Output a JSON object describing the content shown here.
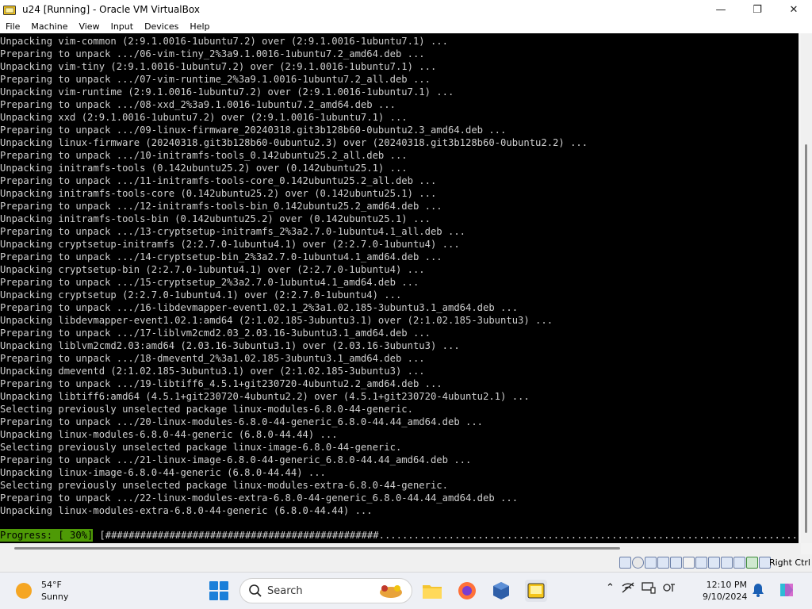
{
  "window": {
    "title": "u24 [Running] - Oracle VM VirtualBox",
    "controls": {
      "minimize": "—",
      "maximize": "❐",
      "close": "✕"
    }
  },
  "menu": [
    "File",
    "Machine",
    "View",
    "Input",
    "Devices",
    "Help"
  ],
  "terminal": {
    "lines": [
      "Unpacking vim-common (2:9.1.0016-1ubuntu7.2) over (2:9.1.0016-1ubuntu7.1) ...",
      "Preparing to unpack .../06-vim-tiny_2%3a9.1.0016-1ubuntu7.2_amd64.deb ...",
      "Unpacking vim-tiny (2:9.1.0016-1ubuntu7.2) over (2:9.1.0016-1ubuntu7.1) ...",
      "Preparing to unpack .../07-vim-runtime_2%3a9.1.0016-1ubuntu7.2_all.deb ...",
      "Unpacking vim-runtime (2:9.1.0016-1ubuntu7.2) over (2:9.1.0016-1ubuntu7.1) ...",
      "Preparing to unpack .../08-xxd_2%3a9.1.0016-1ubuntu7.2_amd64.deb ...",
      "Unpacking xxd (2:9.1.0016-1ubuntu7.2) over (2:9.1.0016-1ubuntu7.1) ...",
      "Preparing to unpack .../09-linux-firmware_20240318.git3b128b60-0ubuntu2.3_amd64.deb ...",
      "Unpacking linux-firmware (20240318.git3b128b60-0ubuntu2.3) over (20240318.git3b128b60-0ubuntu2.2) ...",
      "Preparing to unpack .../10-initramfs-tools_0.142ubuntu25.2_all.deb ...",
      "Unpacking initramfs-tools (0.142ubuntu25.2) over (0.142ubuntu25.1) ...",
      "Preparing to unpack .../11-initramfs-tools-core_0.142ubuntu25.2_all.deb ...",
      "Unpacking initramfs-tools-core (0.142ubuntu25.2) over (0.142ubuntu25.1) ...",
      "Preparing to unpack .../12-initramfs-tools-bin_0.142ubuntu25.2_amd64.deb ...",
      "Unpacking initramfs-tools-bin (0.142ubuntu25.2) over (0.142ubuntu25.1) ...",
      "Preparing to unpack .../13-cryptsetup-initramfs_2%3a2.7.0-1ubuntu4.1_all.deb ...",
      "Unpacking cryptsetup-initramfs (2:2.7.0-1ubuntu4.1) over (2:2.7.0-1ubuntu4) ...",
      "Preparing to unpack .../14-cryptsetup-bin_2%3a2.7.0-1ubuntu4.1_amd64.deb ...",
      "Unpacking cryptsetup-bin (2:2.7.0-1ubuntu4.1) over (2:2.7.0-1ubuntu4) ...",
      "Preparing to unpack .../15-cryptsetup_2%3a2.7.0-1ubuntu4.1_amd64.deb ...",
      "Unpacking cryptsetup (2:2.7.0-1ubuntu4.1) over (2:2.7.0-1ubuntu4) ...",
      "Preparing to unpack .../16-libdevmapper-event1.02.1_2%3a1.02.185-3ubuntu3.1_amd64.deb ...",
      "Unpacking libdevmapper-event1.02.1:amd64 (2:1.02.185-3ubuntu3.1) over (2:1.02.185-3ubuntu3) ...",
      "Preparing to unpack .../17-liblvm2cmd2.03_2.03.16-3ubuntu3.1_amd64.deb ...",
      "Unpacking liblvm2cmd2.03:amd64 (2.03.16-3ubuntu3.1) over (2.03.16-3ubuntu3) ...",
      "Preparing to unpack .../18-dmeventd_2%3a1.02.185-3ubuntu3.1_amd64.deb ...",
      "Unpacking dmeventd (2:1.02.185-3ubuntu3.1) over (2:1.02.185-3ubuntu3) ...",
      "Preparing to unpack .../19-libtiff6_4.5.1+git230720-4ubuntu2.2_amd64.deb ...",
      "Unpacking libtiff6:amd64 (4.5.1+git230720-4ubuntu2.2) over (4.5.1+git230720-4ubuntu2.1) ...",
      "Selecting previously unselected package linux-modules-6.8.0-44-generic.",
      "Preparing to unpack .../20-linux-modules-6.8.0-44-generic_6.8.0-44.44_amd64.deb ...",
      "Unpacking linux-modules-6.8.0-44-generic (6.8.0-44.44) ...",
      "Selecting previously unselected package linux-image-6.8.0-44-generic.",
      "Preparing to unpack .../21-linux-image-6.8.0-44-generic_6.8.0-44.44_amd64.deb ...",
      "Unpacking linux-image-6.8.0-44-generic (6.8.0-44.44) ...",
      "Selecting previously unselected package linux-modules-extra-6.8.0-44-generic.",
      "Preparing to unpack .../22-linux-modules-extra-6.8.0-44-generic_6.8.0-44.44_amd64.deb ...",
      "Unpacking linux-modules-extra-6.8.0-44-generic (6.8.0-44.44) ..."
    ],
    "progress_label": "Progress: [ 30%]",
    "progress_bar": "[###############################################.........................................................................................................................................]"
  },
  "statusbar": {
    "host_key": "Right Ctrl",
    "icons": [
      "hard-disk-icon",
      "optical-drive-icon",
      "audio-icon",
      "network-icon",
      "usb-icon",
      "shared-folders-icon",
      "display-icon",
      "recording-icon",
      "mouse-integration-icon",
      "keyboard-icon",
      "cpu-icon",
      "arrow-icon"
    ]
  },
  "taskbar": {
    "weather_temp": "54°F",
    "weather_cond": "Sunny",
    "search_placeholder": "Search",
    "time": "12:10 PM",
    "date": "9/10/2024"
  },
  "colors": {
    "terminal_bg": "#000000",
    "terminal_text": "#cfcfcf",
    "progress_bg": "#4e9a06",
    "accent": "#1a7fd9"
  }
}
